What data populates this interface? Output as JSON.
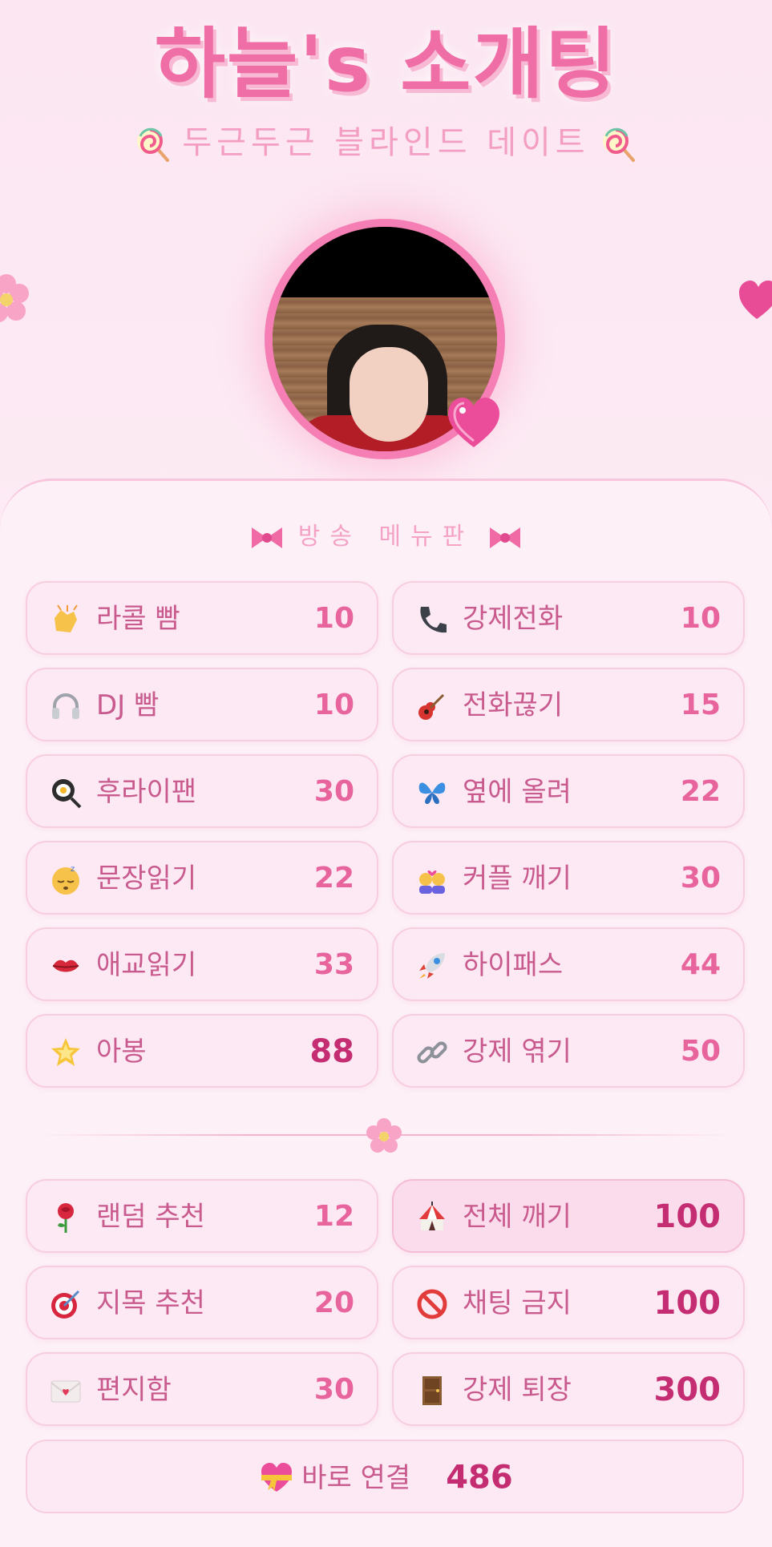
{
  "header": {
    "title": "하늘's 소개팅",
    "subtitle": "두근두근 블라인드 데이트"
  },
  "menu": {
    "title": "방송 메뉴판",
    "group1": [
      {
        "label": "라콜 빰",
        "value": "10",
        "icon": "clapping-hands-icon"
      },
      {
        "label": "강제전화",
        "value": "10",
        "icon": "telephone-icon"
      },
      {
        "label": "DJ 빰",
        "value": "10",
        "icon": "headphones-icon"
      },
      {
        "label": "전화끊기",
        "value": "15",
        "icon": "guitar-icon"
      },
      {
        "label": "후라이팬",
        "value": "30",
        "icon": "frying-pan-icon"
      },
      {
        "label": "옆에 올려",
        "value": "22",
        "icon": "butterfly-icon"
      },
      {
        "label": "문장읽기",
        "value": "22",
        "icon": "sleepy-face-icon"
      },
      {
        "label": "커플 깨기",
        "value": "30",
        "icon": "couple-kiss-icon"
      },
      {
        "label": "애교읽기",
        "value": "33",
        "icon": "kiss-lips-icon"
      },
      {
        "label": "하이패스",
        "value": "44",
        "icon": "rocket-icon"
      },
      {
        "label": "아봉",
        "value": "88",
        "icon": "glowing-star-icon"
      },
      {
        "label": "강제 엮기",
        "value": "50",
        "icon": "link-icon"
      }
    ],
    "group2": [
      {
        "label": "랜덤 추천",
        "value": "12",
        "icon": "rose-icon"
      },
      {
        "label": "전체 깨기",
        "value": "100",
        "icon": "circus-tent-icon"
      },
      {
        "label": "지목 추천",
        "value": "20",
        "icon": "target-icon"
      },
      {
        "label": "채팅 금지",
        "value": "100",
        "icon": "prohibited-icon"
      },
      {
        "label": "편지함",
        "value": "30",
        "icon": "love-letter-icon"
      },
      {
        "label": "강제 퇴장",
        "value": "300",
        "icon": "door-icon"
      }
    ],
    "connect": {
      "label": "바로 연결",
      "value": "486",
      "icon": "heart-ribbon-icon"
    }
  },
  "colors": {
    "accent": "#ef6ea6",
    "value": "#e8649d",
    "value_strong": "#c52d72",
    "label": "#c85a8d",
    "card": "#fde9f3",
    "border": "#f7cde0"
  }
}
